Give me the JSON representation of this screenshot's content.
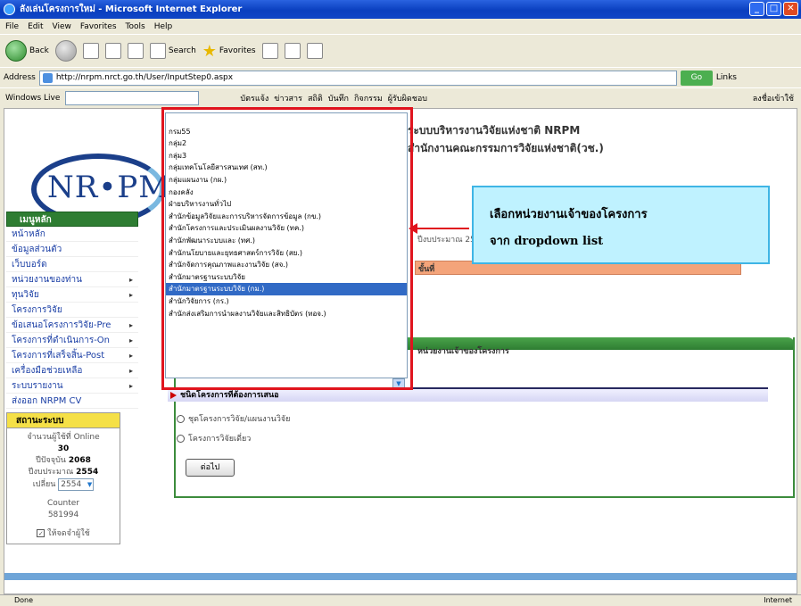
{
  "window": {
    "title": "ลังเล่นโครงการใหม่ - Microsoft Internet Explorer"
  },
  "menu": [
    "File",
    "Edit",
    "View",
    "Favorites",
    "Tools",
    "Help"
  ],
  "toolbar": {
    "back": "Back",
    "search": "Search",
    "favorites": "Favorites"
  },
  "address": {
    "label": "Address",
    "url": "http://nrpm.nrct.go.th/User/InputStep0.aspx",
    "go": "Go",
    "links": "Links"
  },
  "linkbar": {
    "windows_live": "Windows Live",
    "items": [
      "บัตรแจ้ง",
      "ข่าวสาร",
      "สถิติ",
      "บันทึก",
      "กิจกรรม",
      "ผู้รับผิดชอบ"
    ],
    "signin": "ลงชื่อเข้าใช้"
  },
  "header": {
    "line1": "ระบบบริหารงานวิจัยแห่งชาติ NRPM",
    "line2": "สำนักงานคณะกรรมการวิจัยแห่งชาติ(วช.)"
  },
  "logo": {
    "text": "NR•PM"
  },
  "sidebar": {
    "header": "เมนูหลัก",
    "items": [
      {
        "label": "หน้าหลัก",
        "arrow": ""
      },
      {
        "label": "ข้อมูลส่วนตัว",
        "arrow": ""
      },
      {
        "label": "เว็บบอร์ด",
        "arrow": ""
      },
      {
        "label": "หน่วยงานของท่าน",
        "arrow": "▸"
      },
      {
        "label": "ทุนวิจัย",
        "arrow": "▸"
      },
      {
        "label": "โครงการวิจัย",
        "arrow": ""
      },
      {
        "label": "ข้อเสนอโครงการวิจัย-Pre",
        "arrow": "▸"
      },
      {
        "label": "โครงการที่ดำเนินการ-On",
        "arrow": "▸"
      },
      {
        "label": "โครงการที่เสร็จสิ้น-Post",
        "arrow": "▸"
      },
      {
        "label": "เครื่องมือช่วยเหลือ",
        "arrow": "▸"
      },
      {
        "label": "ระบบรายงาน",
        "arrow": "▸"
      },
      {
        "label": "ส่งออก NRPM CV",
        "arrow": ""
      }
    ]
  },
  "stats": {
    "header": "สถานะระบบ",
    "online_label": "จำนวนผู้ใช้ที่ Online",
    "online": "30",
    "year_label": "ปีปัจจุบัน",
    "year_value": "2068",
    "budget_label": "ปีงบประมาณ",
    "budget_value": "2554",
    "select_label": "เปลี่ยน",
    "select_value": "2554",
    "counter_label": "Counter",
    "counter": "581994",
    "remember": "ให้จดจำผู้ใช้"
  },
  "main": {
    "fiscal_year": "ปีงบประมาณ 2554",
    "bar_label": "ขั้นที่",
    "project_owner_label": "หน่วยงานเจ้าของโครงการ",
    "section_header": "ชนิดโครงการที่ต้องการเสนอ",
    "radio1": "ชุดโครงการวิจัย/แผนงานวิจัย",
    "radio2": "โครงการวิจัยเดี่ยว",
    "next_button": "ต่อไป"
  },
  "dropdown": {
    "items": [
      "",
      "กรม55",
      "กลุ่ม2",
      "กลุ่ม3",
      "กลุ่มเทคโนโลยีสารสนเทศ (สท.)",
      "กลุ่มแผนงาน (กผ.)",
      "กองคลัง",
      "ฝ่ายบริหารงานทั่วไป",
      "สำนักข้อมูลวิจัยและการบริหารจัดการข้อมูล (กข.)",
      "สำนักโครงการและประเมินผลงานวิจัย (ทค.)",
      "สำนักพัฒนาระบบและ (ทศ.)",
      "สำนักนโยบายและยุทธศาสตร์การวิจัย (สย.)",
      "สำนักจัดการคุณภาพและงานวิจัย (สจ.)",
      "สำนักมาตรฐานระบบวิจัย",
      "สำนักมาตรฐานระบบวิจัย (กม.)",
      "สำนักวิจัยการ (กร.)",
      "สำนักส่งเสริมการนำผลงานวิจัยและสิทธิบัตร (ทอจ.)"
    ],
    "selected_index": 14
  },
  "callout": {
    "line1": "เลือกหน่วยงานเจ้าของโครงการ",
    "line2": "จาก dropdown list"
  },
  "statusbar": {
    "left": "Done",
    "right": "Internet"
  }
}
